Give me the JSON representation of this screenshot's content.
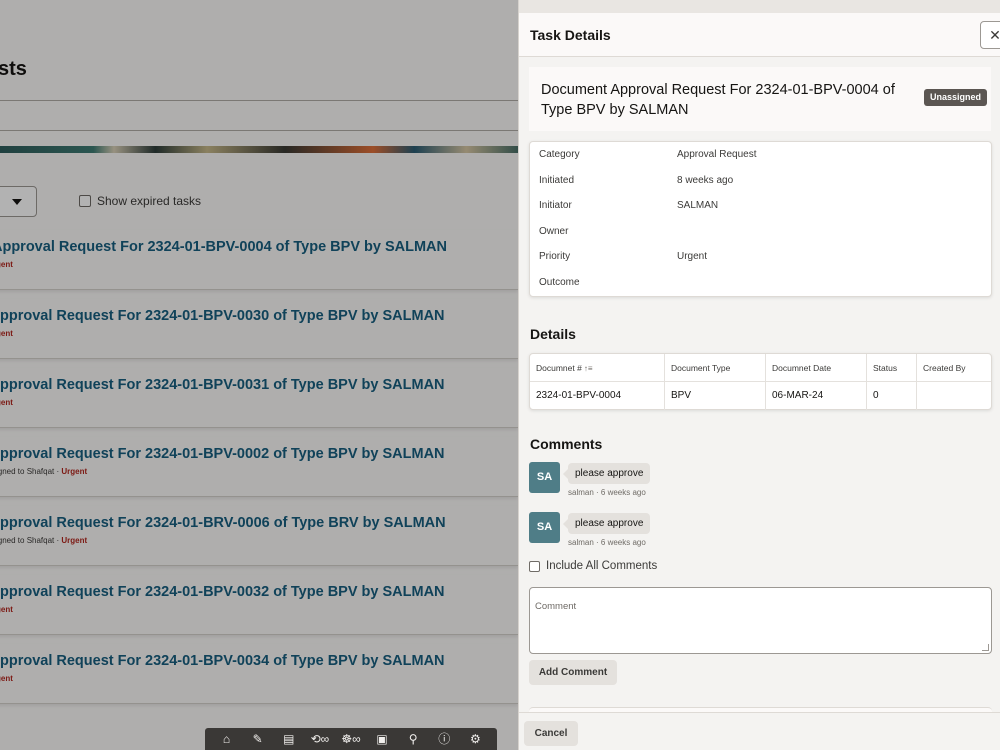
{
  "background": {
    "page_title": "sts",
    "show_expired_label": "Show expired tasks",
    "tasks": [
      {
        "title": "Approval Request For 2324-01-BPV-0004 of Type BPV by SALMAN",
        "meta_prefix": "",
        "priority": "gent"
      },
      {
        "title": "pproval Request For 2324-01-BPV-0030 of Type BPV by SALMAN",
        "meta_prefix": "",
        "priority": "gent"
      },
      {
        "title": "pproval Request For 2324-01-BPV-0031 of Type BPV by SALMAN",
        "meta_prefix": "",
        "priority": "gent"
      },
      {
        "title": "pproval Request For 2324-01-BPV-0002 of Type BPV by SALMAN",
        "meta_prefix": "igned to Shafqat · ",
        "priority": "Urgent"
      },
      {
        "title": "pproval Request For 2324-01-BRV-0006 of Type BRV by SALMAN",
        "meta_prefix": "igned to Shafqat · ",
        "priority": "Urgent"
      },
      {
        "title": "pproval Request For 2324-01-BPV-0032 of Type BPV by SALMAN",
        "meta_prefix": "",
        "priority": "gent"
      },
      {
        "title": "pproval Request For 2324-01-BPV-0034 of Type BPV by SALMAN",
        "meta_prefix": "",
        "priority": "gent"
      }
    ],
    "toolbar_icons": [
      "home-icon",
      "edit-icon",
      "document-edit-icon",
      "history-icon",
      "link-icon",
      "bug-icon",
      "link-icon",
      "screenshot-icon",
      "paint-roller-icon",
      "info-icon",
      "settings-icon"
    ]
  },
  "drawer": {
    "title": "Task Details",
    "close_symbol": "✕",
    "task_title": "Document Approval Request For 2324-01-BPV-0004 of Type BPV by SALMAN",
    "status_badge": "Unassigned",
    "info": [
      {
        "label": "Category",
        "value": "Approval Request"
      },
      {
        "label": "Initiated",
        "value": "8 weeks ago"
      },
      {
        "label": "Initiator",
        "value": "SALMAN"
      },
      {
        "label": "Owner",
        "value": ""
      },
      {
        "label": "Priority",
        "value": "Urgent"
      },
      {
        "label": "Outcome",
        "value": ""
      }
    ],
    "details_heading": "Details",
    "details_columns": [
      "Documnet #",
      "Document Type",
      "Documnet Date",
      "Status",
      "Created By"
    ],
    "details_rows": [
      [
        "2324-01-BPV-0004",
        "BPV",
        "06-MAR-24",
        "0",
        ""
      ]
    ],
    "comments_heading": "Comments",
    "comments": [
      {
        "initials": "SA",
        "text": "please approve",
        "meta": "salman · 6 weeks ago"
      },
      {
        "initials": "SA",
        "text": "please approve",
        "meta": "salman · 6 weeks ago"
      }
    ],
    "include_all_label": "Include All Comments",
    "comment_placeholder": "Comment",
    "add_comment_label": "Add Comment",
    "cancel_label": "Cancel"
  },
  "colors": {
    "link": "#175f80",
    "urgent": "#b3281f",
    "avatar": "#4f7d87",
    "badge": "#5b5652"
  }
}
